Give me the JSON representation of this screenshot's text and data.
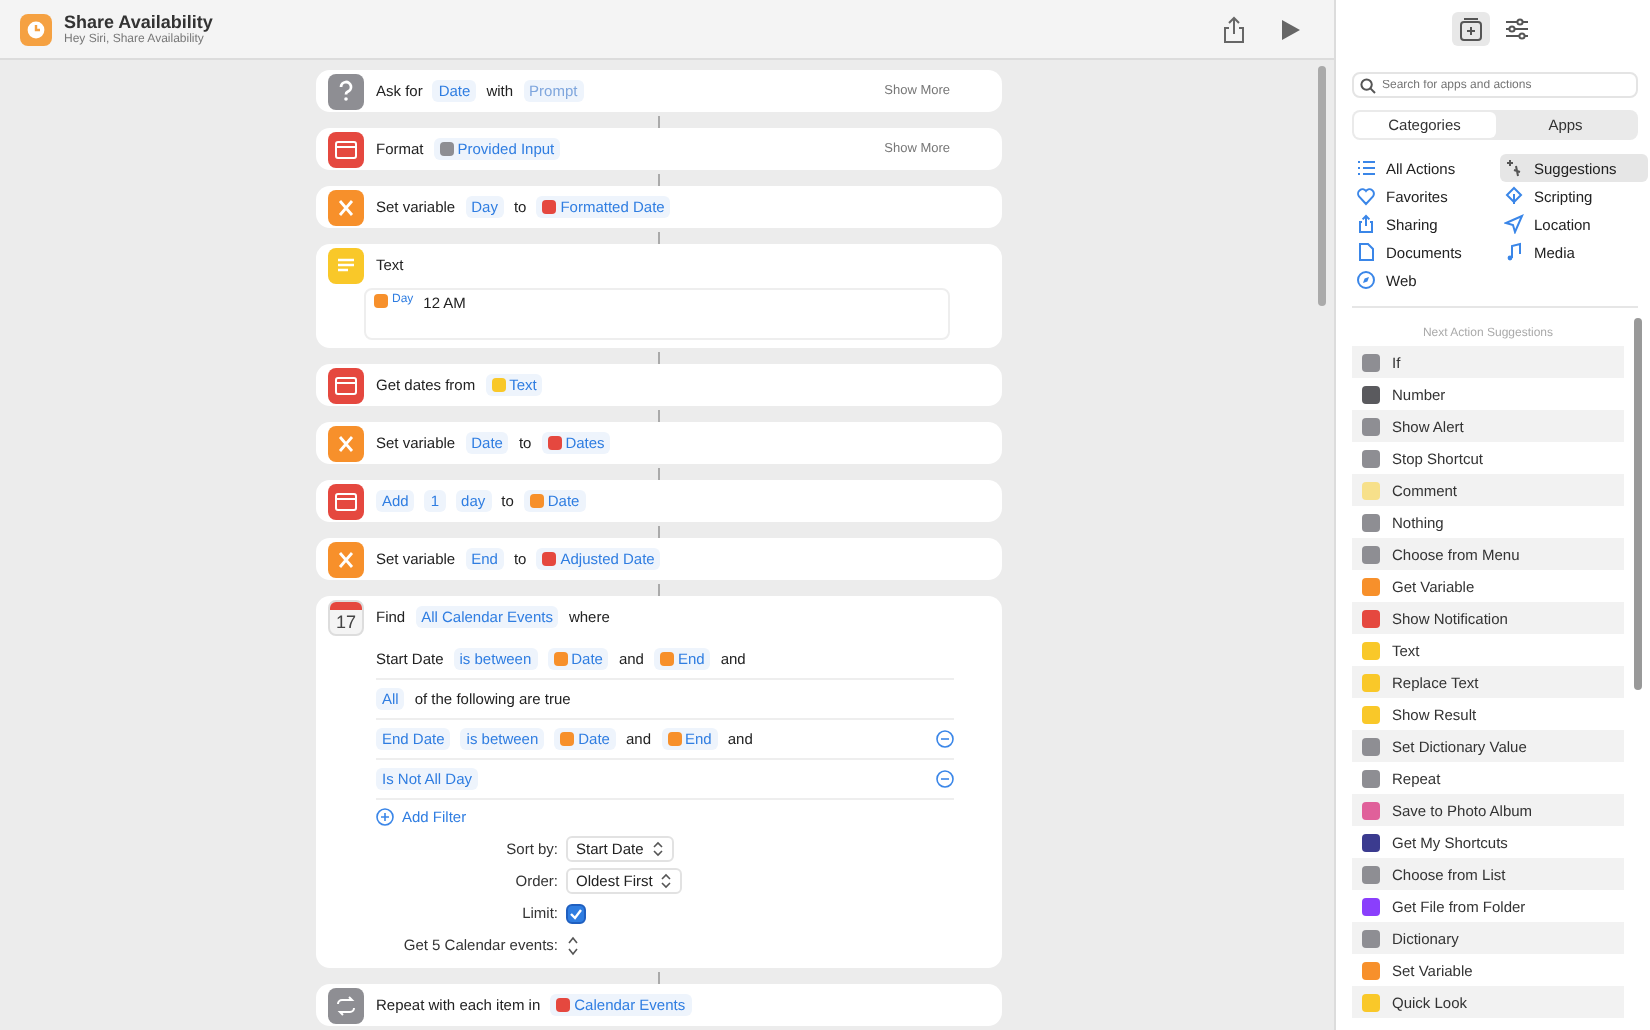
{
  "window": {
    "title": "Share Availability",
    "subtitle": "Hey Siri, Share Availability"
  },
  "actions": [
    {
      "kind": "question",
      "parts": [
        {
          "kind": "label",
          "text": "Ask for"
        },
        {
          "kind": "token",
          "text": "Date"
        },
        {
          "kind": "label",
          "text": "with"
        },
        {
          "kind": "placeholder",
          "text": "Prompt"
        }
      ],
      "show_more": "Show More"
    },
    {
      "kind": "calendar",
      "parts": [
        {
          "kind": "label",
          "text": "Format"
        },
        {
          "kind": "variable",
          "text": "Provided Input",
          "color": "#8e8e93"
        }
      ],
      "show_more": "Show More"
    },
    {
      "kind": "variable",
      "parts": [
        {
          "kind": "label",
          "text": "Set variable"
        },
        {
          "kind": "token",
          "text": "Day"
        },
        {
          "kind": "label",
          "text": "to"
        },
        {
          "kind": "variable",
          "text": "Formatted Date",
          "color": "#e5483f"
        }
      ]
    },
    {
      "kind": "text",
      "parts": [
        {
          "kind": "label",
          "text": "Text"
        }
      ],
      "body": [
        {
          "kind": "variable",
          "text": "Day",
          "color": "#f7902b"
        },
        {
          "kind": "label",
          "text": "12 AM"
        }
      ]
    },
    {
      "kind": "calendar",
      "parts": [
        {
          "kind": "label",
          "text": "Get dates from"
        },
        {
          "kind": "variable",
          "text": "Text",
          "color": "#f9c829"
        }
      ]
    },
    {
      "kind": "variable",
      "parts": [
        {
          "kind": "label",
          "text": "Set variable"
        },
        {
          "kind": "token",
          "text": "Date"
        },
        {
          "kind": "label",
          "text": "to"
        },
        {
          "kind": "variable",
          "text": "Dates",
          "color": "#e5483f"
        }
      ]
    },
    {
      "kind": "calendar",
      "parts": [
        {
          "kind": "token",
          "text": "Add"
        },
        {
          "kind": "token",
          "text": "1"
        },
        {
          "kind": "token",
          "text": "day"
        },
        {
          "kind": "label",
          "text": "to"
        },
        {
          "kind": "variable",
          "text": "Date",
          "color": "#f7902b"
        }
      ]
    },
    {
      "kind": "variable",
      "parts": [
        {
          "kind": "label",
          "text": "Set variable"
        },
        {
          "kind": "token",
          "text": "End"
        },
        {
          "kind": "label",
          "text": "to"
        },
        {
          "kind": "variable",
          "text": "Adjusted Date",
          "color": "#e5483f"
        }
      ]
    },
    {
      "kind": "calendar-date",
      "date": "17",
      "parts": [
        {
          "kind": "label",
          "text": "Find"
        },
        {
          "kind": "token",
          "text": "All Calendar Events"
        },
        {
          "kind": "label",
          "text": "where"
        }
      ],
      "filters": [
        {
          "removable": false,
          "parts": [
            {
              "kind": "label",
              "text": "Start Date"
            },
            {
              "kind": "token",
              "text": "is between"
            },
            {
              "kind": "variable",
              "text": "Date",
              "color": "#f7902b"
            },
            {
              "kind": "label",
              "text": "and"
            },
            {
              "kind": "variable",
              "text": "End",
              "color": "#f7902b"
            },
            {
              "kind": "label",
              "text": "and"
            }
          ]
        },
        {
          "removable": false,
          "parts": [
            {
              "kind": "token",
              "text": "All"
            },
            {
              "kind": "label",
              "text": "of the following are true"
            }
          ]
        },
        {
          "removable": true,
          "parts": [
            {
              "kind": "token",
              "text": "End Date"
            },
            {
              "kind": "token",
              "text": "is between"
            },
            {
              "kind": "variable",
              "text": "Date",
              "color": "#f7902b"
            },
            {
              "kind": "label",
              "text": "and"
            },
            {
              "kind": "variable",
              "text": "End",
              "color": "#f7902b"
            },
            {
              "kind": "label",
              "text": "and"
            }
          ]
        },
        {
          "removable": true,
          "parts": [
            {
              "kind": "token",
              "text": "Is Not All Day"
            }
          ]
        }
      ],
      "add_filter": "Add Filter",
      "options": [
        {
          "kind": "popup",
          "label": "Sort by:",
          "value": "Start Date"
        },
        {
          "kind": "popup",
          "label": "Order:",
          "value": "Oldest First"
        },
        {
          "kind": "checkbox",
          "label": "Limit:",
          "checked": true
        },
        {
          "kind": "stepper",
          "label": "Get 5 Calendar events:"
        }
      ]
    },
    {
      "kind": "repeat",
      "parts": [
        {
          "kind": "label",
          "text": "Repeat with each item in"
        },
        {
          "kind": "variable",
          "text": "Calendar Events",
          "color": "#e5483f"
        }
      ]
    }
  ],
  "panel": {
    "tabs": [
      {
        "kind": "add-action",
        "selected": true
      },
      {
        "kind": "sliders",
        "selected": false
      }
    ],
    "search": {
      "placeholder": "Search for apps and actions"
    },
    "segments": [
      {
        "label": "Categories",
        "selected": true
      },
      {
        "label": "Apps",
        "selected": false
      }
    ],
    "categories": [
      {
        "label": "All Actions",
        "kind": "list",
        "selected": false
      },
      {
        "label": "Favorites",
        "kind": "heart",
        "selected": false
      },
      {
        "label": "Sharing",
        "kind": "share",
        "selected": false
      },
      {
        "label": "Documents",
        "kind": "document",
        "selected": false
      },
      {
        "label": "Web",
        "kind": "compass",
        "selected": false
      },
      {
        "label": "Suggestions",
        "kind": "sparkle",
        "selected": true
      },
      {
        "label": "Scripting",
        "kind": "scripting",
        "selected": false
      },
      {
        "label": "Location",
        "kind": "location",
        "selected": false
      },
      {
        "label": "Media",
        "kind": "note",
        "selected": false
      }
    ],
    "suggestions_title": "Next Action Suggestions",
    "suggestions": [
      {
        "label": "If",
        "color": "#8e8e93"
      },
      {
        "label": "Number",
        "color": "#5a5a5e"
      },
      {
        "label": "Show Alert",
        "color": "#8e8e93"
      },
      {
        "label": "Stop Shortcut",
        "color": "#8e8e93"
      },
      {
        "label": "Comment",
        "color": "#f7e08a"
      },
      {
        "label": "Nothing",
        "color": "#8e8e93"
      },
      {
        "label": "Choose from Menu",
        "color": "#8e8e93"
      },
      {
        "label": "Get Variable",
        "color": "#f7902b"
      },
      {
        "label": "Show Notification",
        "color": "#e5483f"
      },
      {
        "label": "Text",
        "color": "#f9c829"
      },
      {
        "label": "Replace Text",
        "color": "#f9c829"
      },
      {
        "label": "Show Result",
        "color": "#f9c829"
      },
      {
        "label": "Set Dictionary Value",
        "color": "#8e8e93"
      },
      {
        "label": "Repeat",
        "color": "#8e8e93"
      },
      {
        "label": "Save to Photo Album",
        "color": "#e0609a"
      },
      {
        "label": "Get My Shortcuts",
        "color": "#3b3b8f"
      },
      {
        "label": "Choose from List",
        "color": "#8e8e93"
      },
      {
        "label": "Get File from Folder",
        "color": "#8a3ffc"
      },
      {
        "label": "Dictionary",
        "color": "#8e8e93"
      },
      {
        "label": "Set Variable",
        "color": "#f7902b"
      },
      {
        "label": "Quick Look",
        "color": "#f9c829"
      }
    ]
  }
}
